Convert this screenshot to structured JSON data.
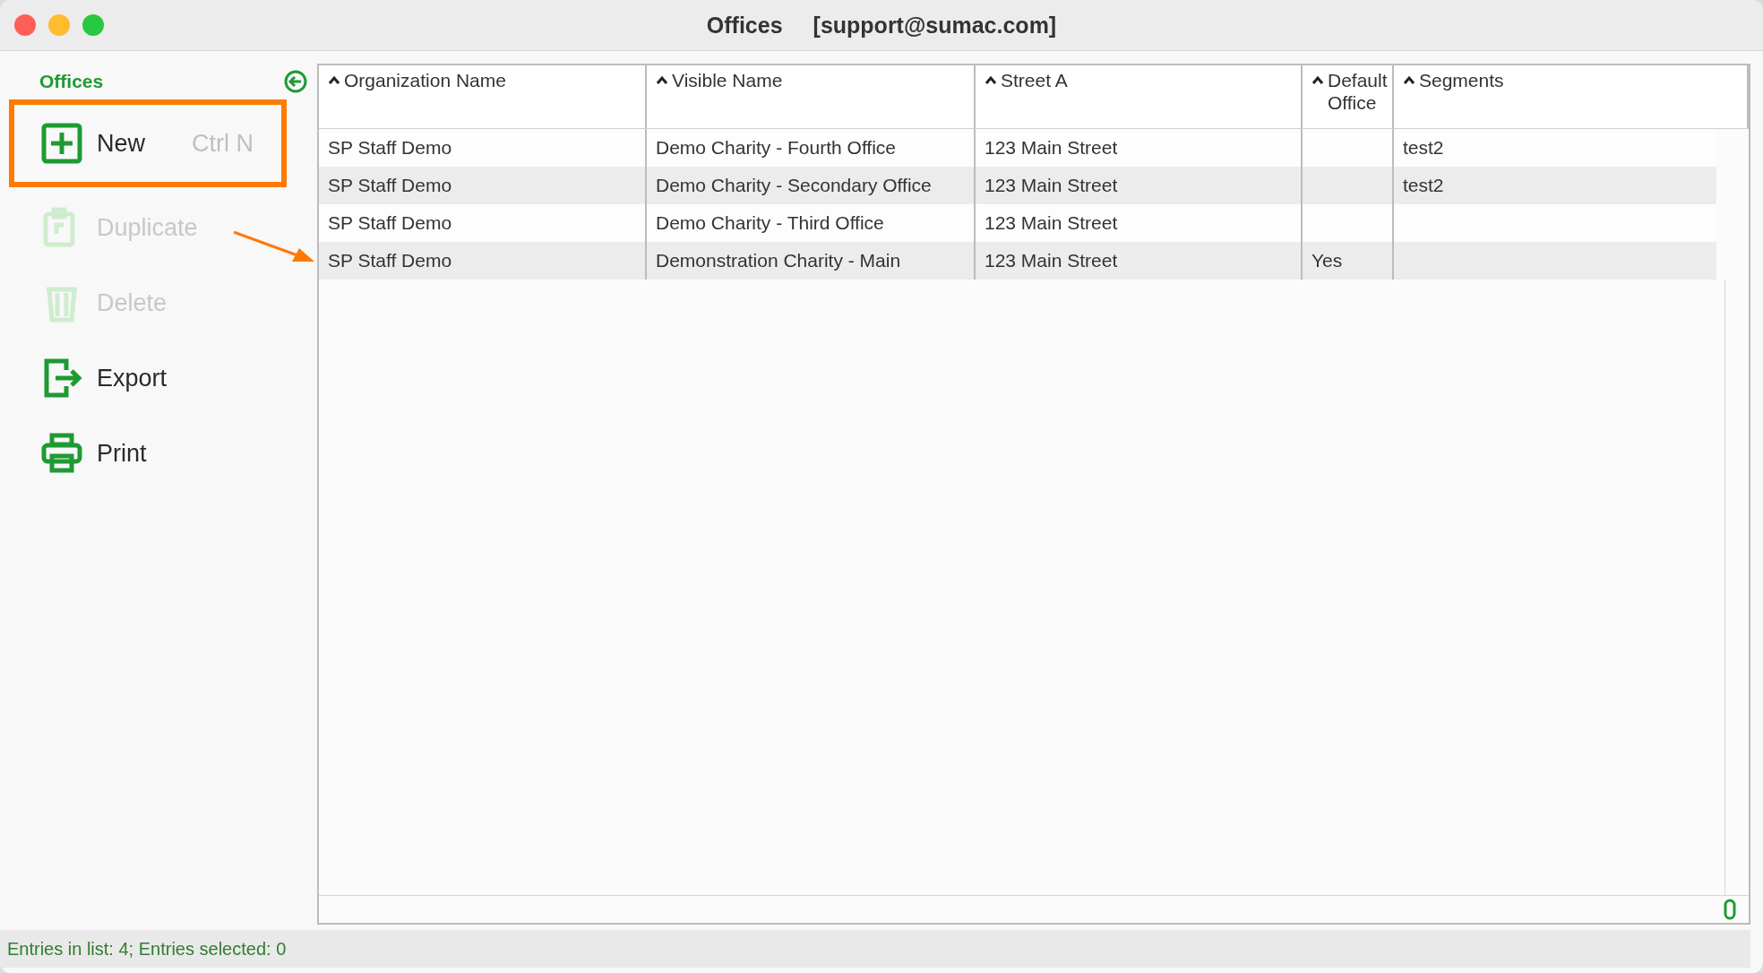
{
  "window": {
    "title": "Offices",
    "account": "[support@sumac.com]"
  },
  "sidebar": {
    "title": "Offices",
    "items": [
      {
        "kind": "new",
        "label": "New",
        "shortcut": "Ctrl N",
        "disabled": false,
        "highlighted": true
      },
      {
        "kind": "duplicate",
        "label": "Duplicate",
        "disabled": true,
        "highlighted": false
      },
      {
        "kind": "delete",
        "label": "Delete",
        "disabled": true,
        "highlighted": false
      },
      {
        "kind": "export",
        "label": "Export",
        "disabled": false,
        "highlighted": false
      },
      {
        "kind": "print",
        "label": "Print",
        "disabled": false,
        "highlighted": false
      }
    ]
  },
  "table": {
    "columns": [
      "Organization Name",
      "Visible Name",
      "Street A",
      "Default Office",
      "Segments"
    ],
    "rows": [
      {
        "cells": [
          "SP Staff Demo",
          "Demo Charity - Fourth Office",
          "123 Main Street",
          "",
          "test2"
        ],
        "pointed": false
      },
      {
        "cells": [
          "SP Staff Demo",
          "Demo Charity - Secondary Office",
          "123 Main Street",
          "",
          "test2"
        ],
        "pointed": false
      },
      {
        "cells": [
          "SP Staff Demo",
          "Demo Charity - Third Office",
          "123 Main Street",
          "",
          ""
        ],
        "pointed": false
      },
      {
        "cells": [
          "SP Staff Demo",
          "Demonstration Charity - Main",
          "123 Main Street",
          "Yes",
          ""
        ],
        "pointed": true
      }
    ]
  },
  "status_bar": "Entries in list: 4; Entries selected: 0"
}
